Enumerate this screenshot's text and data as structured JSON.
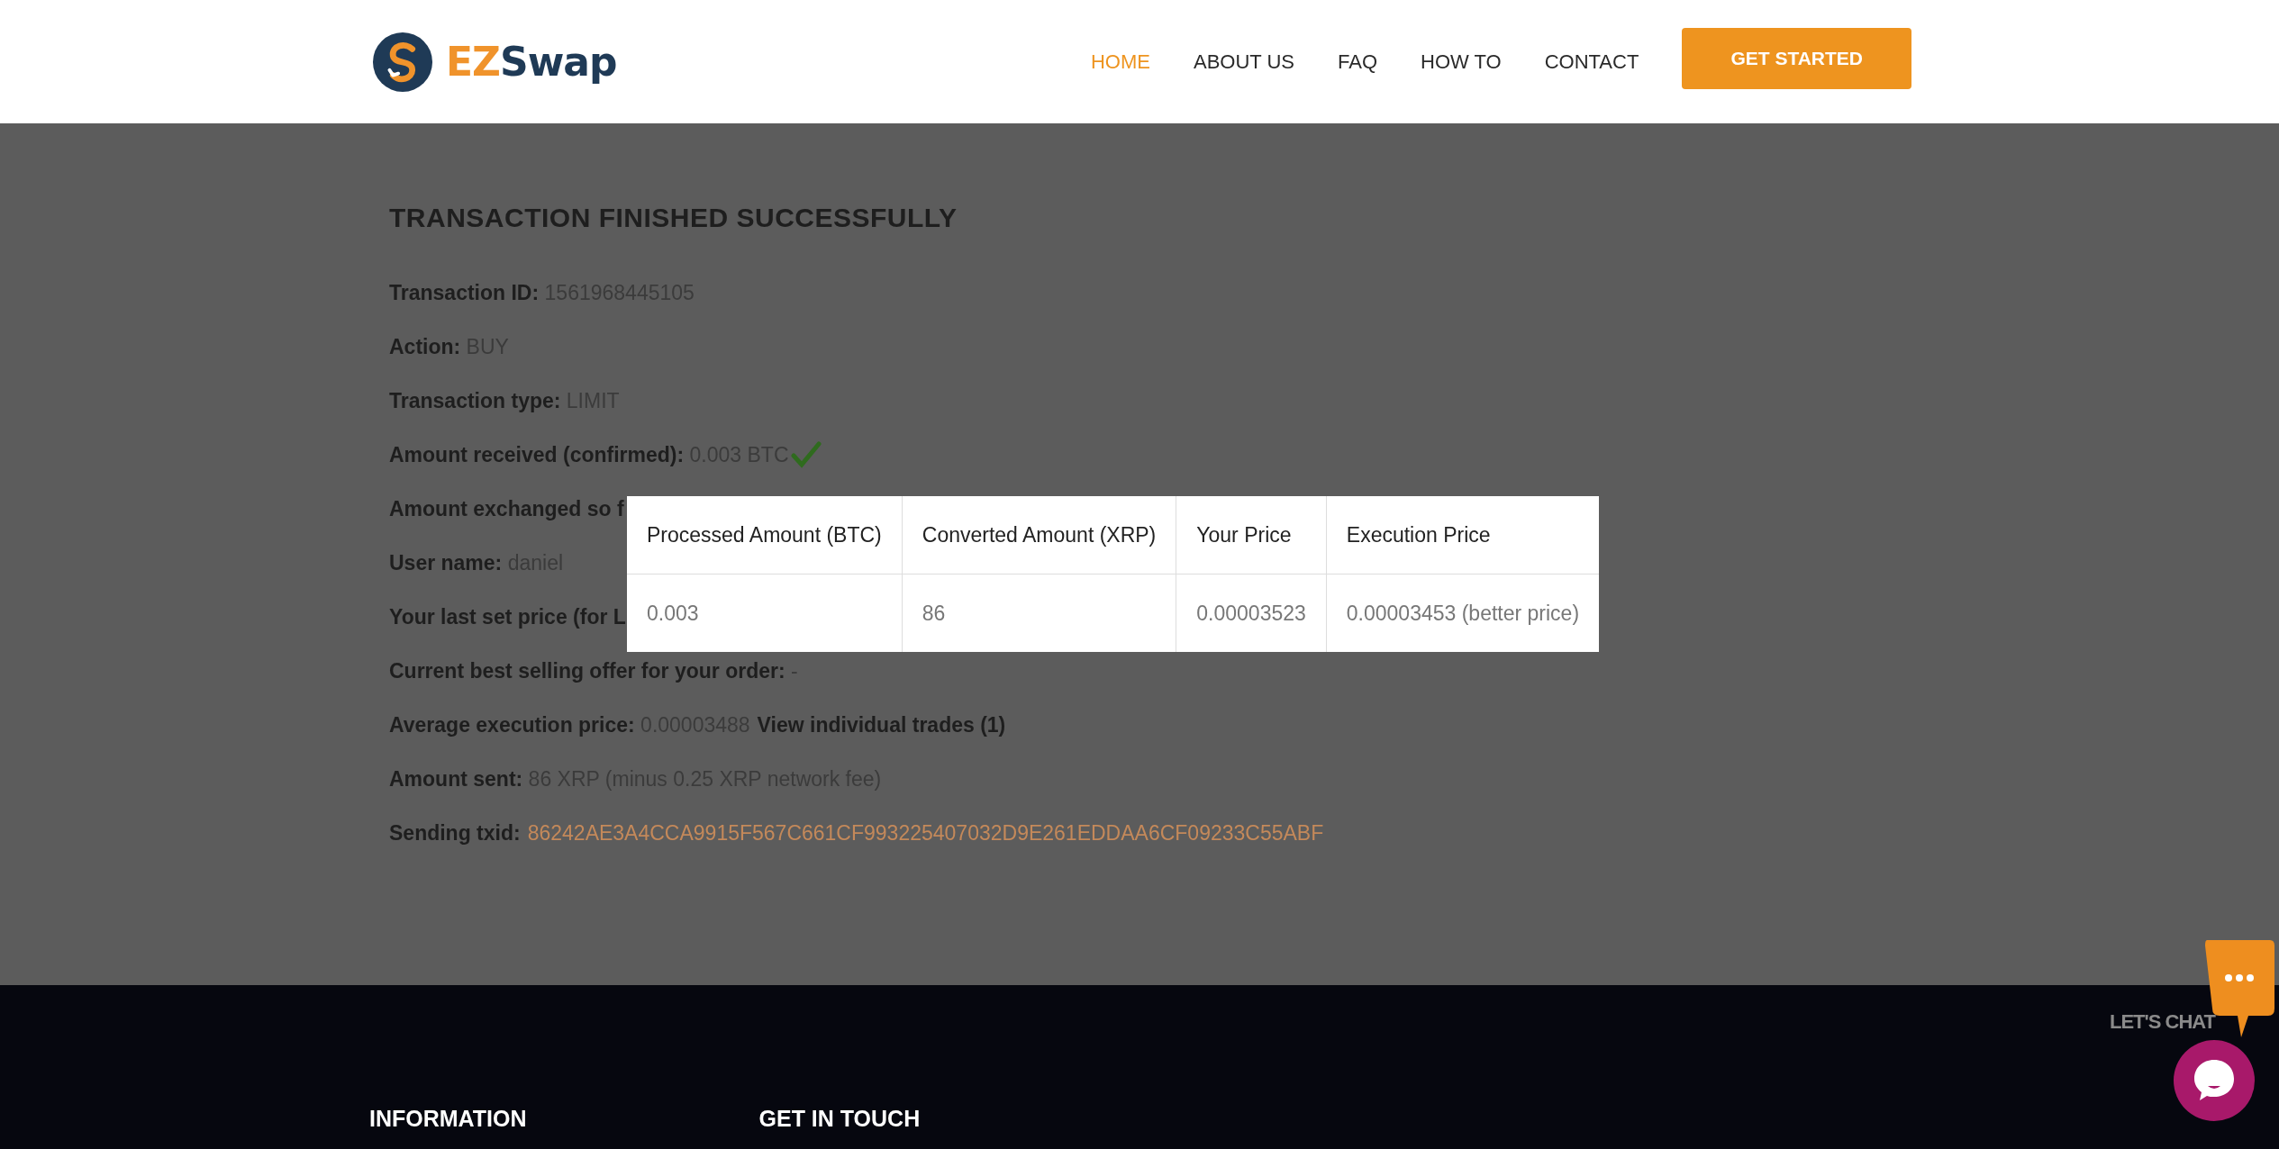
{
  "header": {
    "logo": {
      "parts": [
        "EZ",
        "Swap"
      ]
    },
    "nav": [
      {
        "label": "HOME",
        "selected": true
      },
      {
        "label": "ABOUT US",
        "selected": false
      },
      {
        "label": "FAQ",
        "selected": false
      },
      {
        "label": "HOW TO",
        "selected": false
      },
      {
        "label": "CONTACT",
        "selected": false
      }
    ],
    "cta": "GET STARTED"
  },
  "transaction": {
    "title": "TRANSACTION FINISHED SUCCESSFULLY",
    "rows": [
      {
        "kind": "plain",
        "label": "Transaction ID:",
        "value": "1561968445105"
      },
      {
        "kind": "plain",
        "label": "Action:",
        "value": "BUY"
      },
      {
        "kind": "plain",
        "label": "Transaction type:",
        "value": "LIMIT"
      },
      {
        "kind": "confirmed",
        "label": "Amount received (confirmed):",
        "value": "0.003 BTC"
      },
      {
        "kind": "cut",
        "label": "Amount exchanged so f"
      },
      {
        "kind": "plain",
        "label": "User name:",
        "value": "daniel"
      },
      {
        "kind": "cut",
        "label": "Your last set price (for L"
      },
      {
        "kind": "plain",
        "label": "Current best selling offer for your order:",
        "value": "-"
      },
      {
        "kind": "trades",
        "label": "Average execution price:",
        "value": "0.00003488",
        "link": "View individual trades (1)"
      },
      {
        "kind": "plain",
        "label": "Amount sent:",
        "value": "86 XRP (minus 0.25 XRP network fee)"
      },
      {
        "kind": "txid",
        "label": "Sending txid:",
        "value": "86242AE3A4CCA9915F567C661CF993225407032D9E261EDDAA6CF09233C55ABF"
      }
    ]
  },
  "trades_table": {
    "columns": [
      "Processed Amount (BTC)",
      "Converted Amount (XRP)",
      "Your Price",
      "Execution Price"
    ],
    "rows": [
      [
        "0.003",
        "86",
        "0.00003523",
        "0.00003453 (better price)"
      ]
    ]
  },
  "footer": {
    "headings": [
      "INFORMATION",
      "GET IN TOUCH"
    ]
  },
  "chat": {
    "label": "LET'S CHAT"
  }
}
